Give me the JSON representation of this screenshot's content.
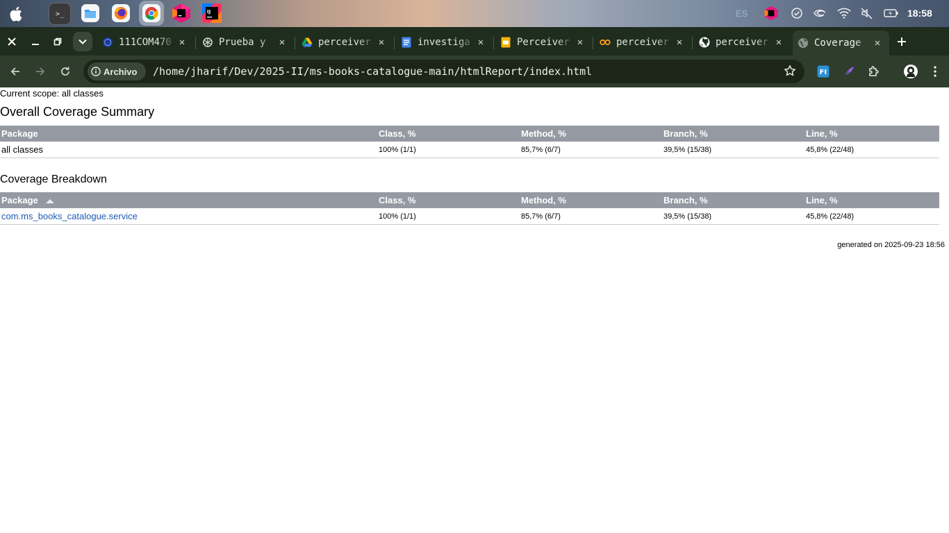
{
  "desktop": {
    "dock": [
      "apple-menu",
      "terminal",
      "files",
      "firefox",
      "chrome",
      "jetbrains-toolbox",
      "intellij-idea"
    ],
    "tray": {
      "language": "ES",
      "clock": "18:58"
    },
    "terminal_glyph": ">_",
    "intellij_glyph": "IJ"
  },
  "browser": {
    "tabs": [
      {
        "title": "111COM470",
        "icon": "globe-icon"
      },
      {
        "title": "Prueba y",
        "icon": "chatgpt-icon"
      },
      {
        "title": "perceiver",
        "icon": "google-drive-icon"
      },
      {
        "title": "investiga",
        "icon": "google-docs-icon"
      },
      {
        "title": "Perceiver",
        "icon": "google-slides-icon"
      },
      {
        "title": "perceiver",
        "icon": "infinity-icon"
      },
      {
        "title": "perceiver",
        "icon": "github-icon"
      },
      {
        "title": "Coverage",
        "icon": "globe-icon",
        "active": true
      }
    ],
    "site_chip": "Archivo",
    "url": "/home/jharif/Dev/2025-II/ms-books-catalogue-main/htmlReport/index.html",
    "extension_fi_label": "FI"
  },
  "report": {
    "scope": "Current scope: all classes",
    "summary_title": "Overall Coverage Summary",
    "breakdown_title": "Coverage Breakdown",
    "headers": {
      "package": "Package",
      "class": "Class, %",
      "method": "Method, %",
      "branch": "Branch, %",
      "line": "Line, %"
    },
    "summary_row": {
      "package": "all classes",
      "class": "100% (1/1)",
      "method": "85,7% (6/7)",
      "branch": "39,5% (15/38)",
      "line": "45,8% (22/48)"
    },
    "breakdown_rows": [
      {
        "package": "com.ms_books_catalogue.service",
        "class": "100% (1/1)",
        "method": "85,7% (6/7)",
        "branch": "39,5% (15/38)",
        "line": "45,8% (22/48)"
      }
    ],
    "generated": "generated on 2025-09-23 18:56"
  }
}
